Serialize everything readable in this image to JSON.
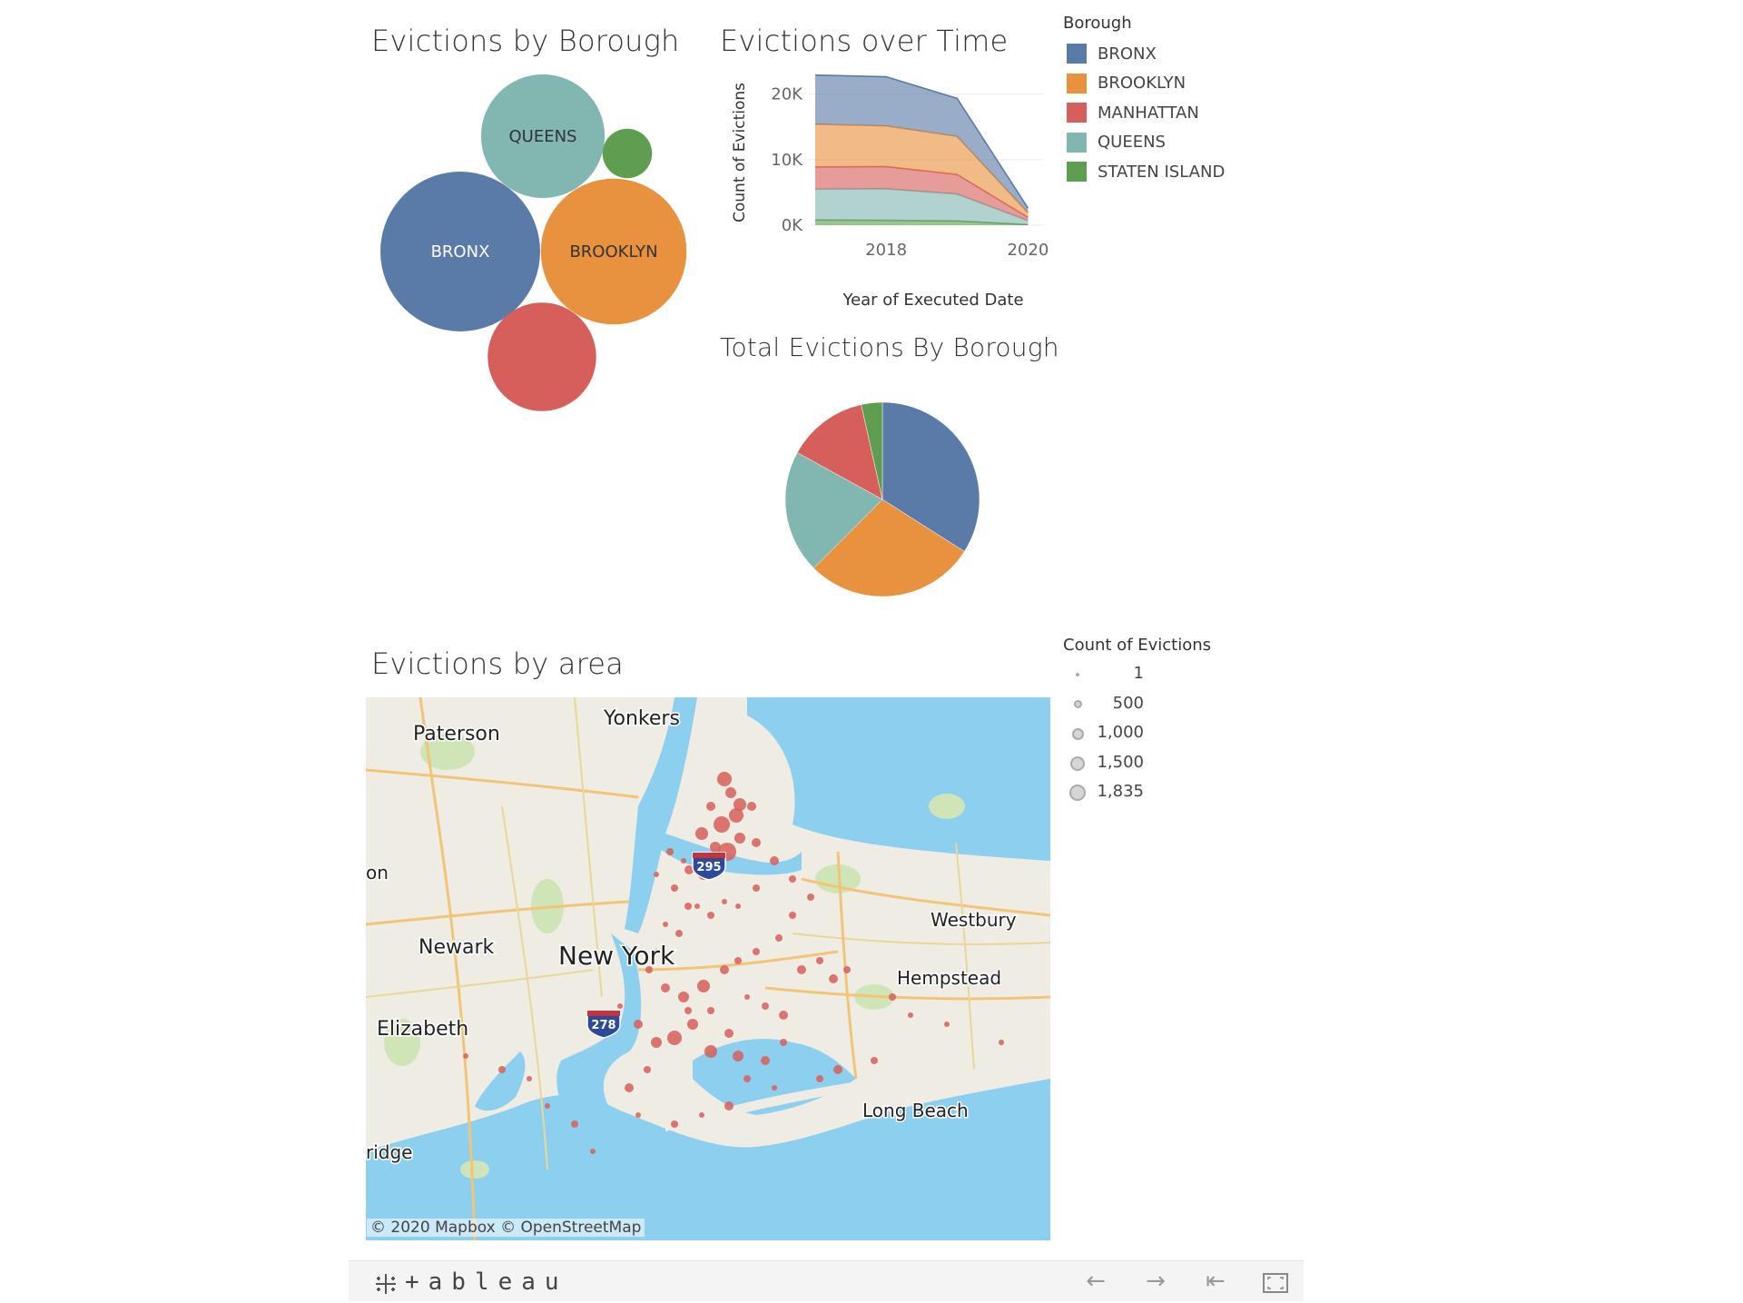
{
  "colors": {
    "BRONX": "#5a7aa8",
    "BROOKLYN": "#e8923f",
    "MANHATTAN": "#d75f5b",
    "QUEENS": "#82b6b1",
    "STATEN ISLAND": "#5f9e50",
    "map_water": "#8ccfee",
    "map_land": "#efece4",
    "map_dot": "#d75f5b"
  },
  "titles": {
    "bubble": "Evictions by Borough",
    "area": "Evictions over Time",
    "pie": "Total Evictions By Borough",
    "map": "Evictions by area"
  },
  "legend_borough": {
    "title": "Borough",
    "items": [
      "BRONX",
      "BROOKLYN",
      "MANHATTAN",
      "QUEENS",
      "STATEN ISLAND"
    ]
  },
  "legend_size": {
    "title": "Count of Evictions",
    "items": [
      "1",
      "500",
      "1,000",
      "1,500",
      "1,835"
    ]
  },
  "map": {
    "labels": [
      "Paterson",
      "Yonkers",
      "Newark",
      "New York",
      "Elizabeth",
      "Westbury",
      "Hempstead",
      "Long Beach",
      "ridge",
      "on"
    ],
    "shields": [
      "295",
      "278"
    ],
    "attribution": "© 2020 Mapbox  © OpenStreetMap"
  },
  "footer": {
    "logo": "+ableau",
    "nav_icons": [
      "back-arrow-icon",
      "forward-arrow-icon",
      "first-page-icon",
      "fullscreen-icon"
    ]
  },
  "chart_data": [
    {
      "type": "bubble",
      "title": "Evictions by Borough",
      "categories": [
        "BRONX",
        "BROOKLYN",
        "MANHATTAN",
        "QUEENS",
        "STATEN ISLAND"
      ],
      "values": [
        16700,
        13900,
        7700,
        10000,
        1600
      ],
      "labels_shown": [
        "BRONX",
        "BROOKLYN",
        "",
        "QUEENS",
        ""
      ]
    },
    {
      "type": "area",
      "title": "Evictions over Time",
      "xlabel": "Year of Executed Date",
      "ylabel": "Count of Evictions",
      "x": [
        2017,
        2018,
        2019,
        2020
      ],
      "x_ticks": [
        "2018",
        "2020"
      ],
      "y_ticks": [
        "0K",
        "10K",
        "20K"
      ],
      "ylim": [
        0,
        23000
      ],
      "stacked": true,
      "series": [
        {
          "name": "STATEN ISLAND",
          "values": [
            800,
            750,
            650,
            100
          ]
        },
        {
          "name": "QUEENS",
          "values": [
            4700,
            4800,
            4100,
            600
          ]
        },
        {
          "name": "MANHATTAN",
          "values": [
            3400,
            3400,
            3000,
            500
          ]
        },
        {
          "name": "BROOKLYN",
          "values": [
            6500,
            6200,
            5800,
            700
          ]
        },
        {
          "name": "BRONX",
          "values": [
            7500,
            7500,
            5800,
            700
          ]
        }
      ]
    },
    {
      "type": "pie",
      "title": "Total Evictions By Borough",
      "categories": [
        "BRONX",
        "BROOKLYN",
        "QUEENS",
        "MANHATTAN",
        "STATEN ISLAND"
      ],
      "values": [
        34.0,
        28.5,
        20.5,
        13.5,
        3.5
      ]
    }
  ]
}
